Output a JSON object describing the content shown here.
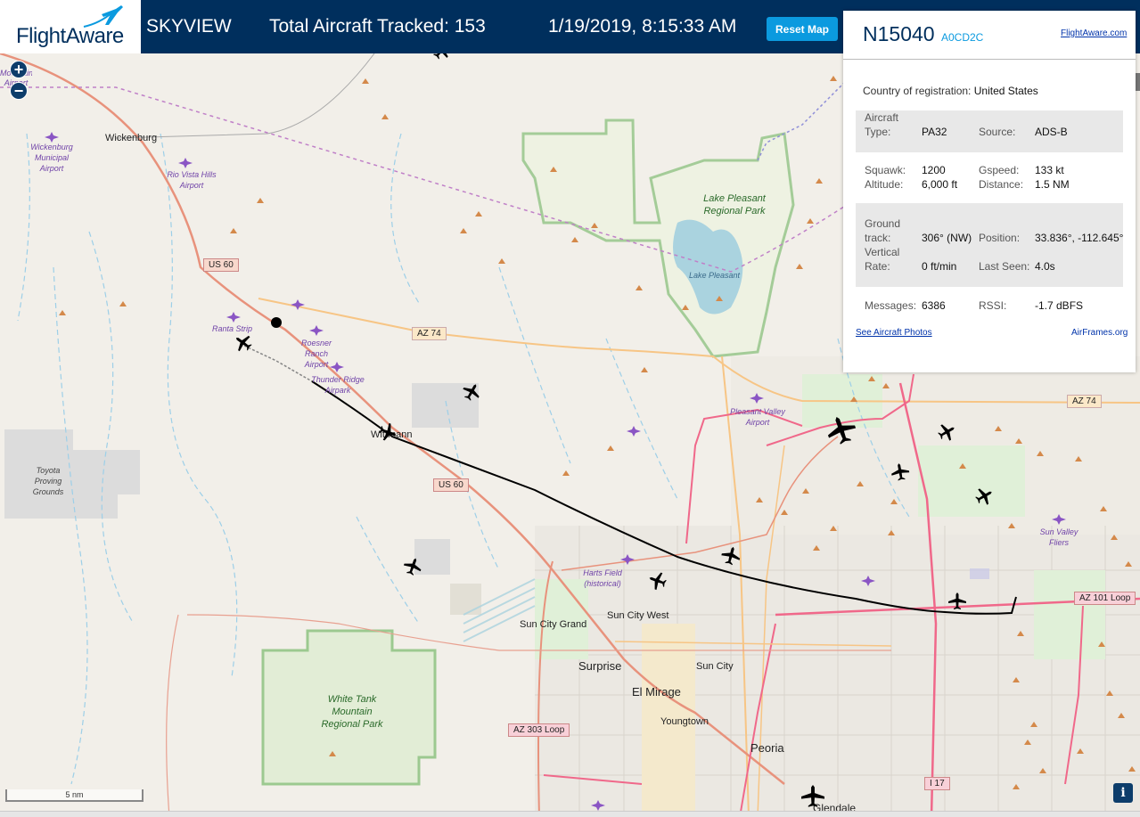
{
  "header": {
    "logo_text": "FlightAware",
    "title": "SKYVIEW",
    "total_label": "Total Aircraft Tracked: 153",
    "timestamp": "1/19/2019, 8:15:33 AM",
    "reset_label": "Reset Map"
  },
  "map": {
    "zoom_in": "+",
    "zoom_out": "−",
    "scale": "5 nm",
    "info": "i",
    "places": {
      "wickenburg": "Wickenburg",
      "wickenburg_airport": "Wickenburg Municipal Airport",
      "rio_vista": "Rio Vista Hills Airport",
      "ranta": "Ranta Strip",
      "roesner": "Roesner Ranch Airport",
      "thunder": "Thunder Ridge Airpark",
      "wittmann": "Wittmann",
      "toyota": "Toyota Proving Grounds",
      "lake_park": "Lake Pleasant Regional Park",
      "lake": "Lake Pleasant",
      "pleasant_valley": "Pleasant Valley Airport",
      "sun_valley": "Sun Valley Fliers",
      "harts": "Harts Field (historical)",
      "sun_city_west": "Sun City West",
      "sun_city_grand": "Sun City Grand",
      "surprise": "Surprise",
      "sun_city": "Sun City",
      "el_mirage": "El Mirage",
      "youngtown": "Youngtown",
      "peoria": "Peoria",
      "glendale": "Glendale",
      "white_tank": "White Tank Mountain Regional Park",
      "mountain_airport": "Mountain Airport"
    },
    "roads": {
      "us60_a": "US 60",
      "us60_b": "US 60",
      "az74_a": "AZ 74",
      "az74_b": "AZ 74",
      "az101": "AZ 101 Loop",
      "az303": "AZ 303 Loop",
      "i17": "I 17"
    }
  },
  "panel": {
    "registration": "N15040",
    "hex": "A0CD2C",
    "fa_link": "FlightAware.com",
    "country_label": "Country of registration:",
    "country_value": "United States",
    "fields": {
      "aircraft_type_label": "Aircraft Type:",
      "aircraft_type": "PA32",
      "source_label": "Source:",
      "source": "ADS-B",
      "squawk_label": "Squawk:",
      "squawk": "1200",
      "gspeed_label": "Gspeed:",
      "gspeed": "133 kt",
      "altitude_label": "Altitude:",
      "altitude": "6,000 ft",
      "distance_label": "Distance:",
      "distance": "1.5 NM",
      "track_label": "Ground track:",
      "track": "306° (NW)",
      "position_label": "Position:",
      "position": "33.836°, -112.645°",
      "vrate_label": "Vertical Rate:",
      "vrate": "0 ft/min",
      "lastseen_label": "Last Seen:",
      "lastseen": "4.0s",
      "messages_label": "Messages:",
      "messages": "6386",
      "rssi_label": "RSSI:",
      "rssi": "-1.7 dBFS"
    },
    "photos_link": "See Aircraft Photos",
    "airframes_link": "AirFrames.org"
  },
  "colors": {
    "header_bg": "#002f5d",
    "accent": "#0b9adf",
    "highway": "#e8927c",
    "state_route": "#f7c585",
    "park_border": "#9cc990",
    "water": "#aad3df",
    "track": "#000000"
  }
}
